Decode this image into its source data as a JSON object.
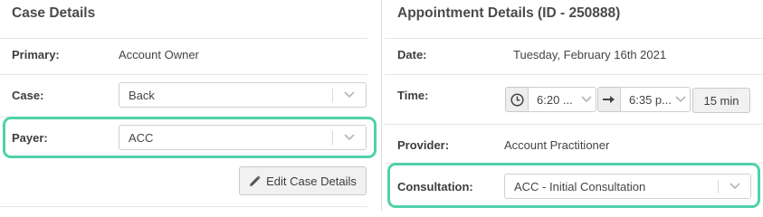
{
  "case_details": {
    "title": "Case Details",
    "primary_label": "Primary:",
    "primary_value": "Account Owner",
    "case_label": "Case:",
    "case_value": "Back",
    "payer_label": "Payer:",
    "payer_value": "ACC",
    "edit_button_label": "Edit Case Details"
  },
  "appointment_details": {
    "title": "Appointment Details (ID - 250888)",
    "date_label": "Date:",
    "date_value": "Tuesday, February 16th 2021",
    "time_label": "Time:",
    "start_time": "6:20 ...",
    "end_time": "6:35 p...",
    "duration": "15 min",
    "provider_label": "Provider:",
    "provider_value": "Account Practitioner",
    "consultation_label": "Consultation:",
    "consultation_value": "ACC - Initial Consultation"
  },
  "icons": {
    "clock": "clock-icon",
    "arrow": "arrow-right-icon",
    "pencil": "pencil-icon",
    "chevron": "chevron-down-icon"
  },
  "colors": {
    "highlight": "#4fd1aa"
  }
}
